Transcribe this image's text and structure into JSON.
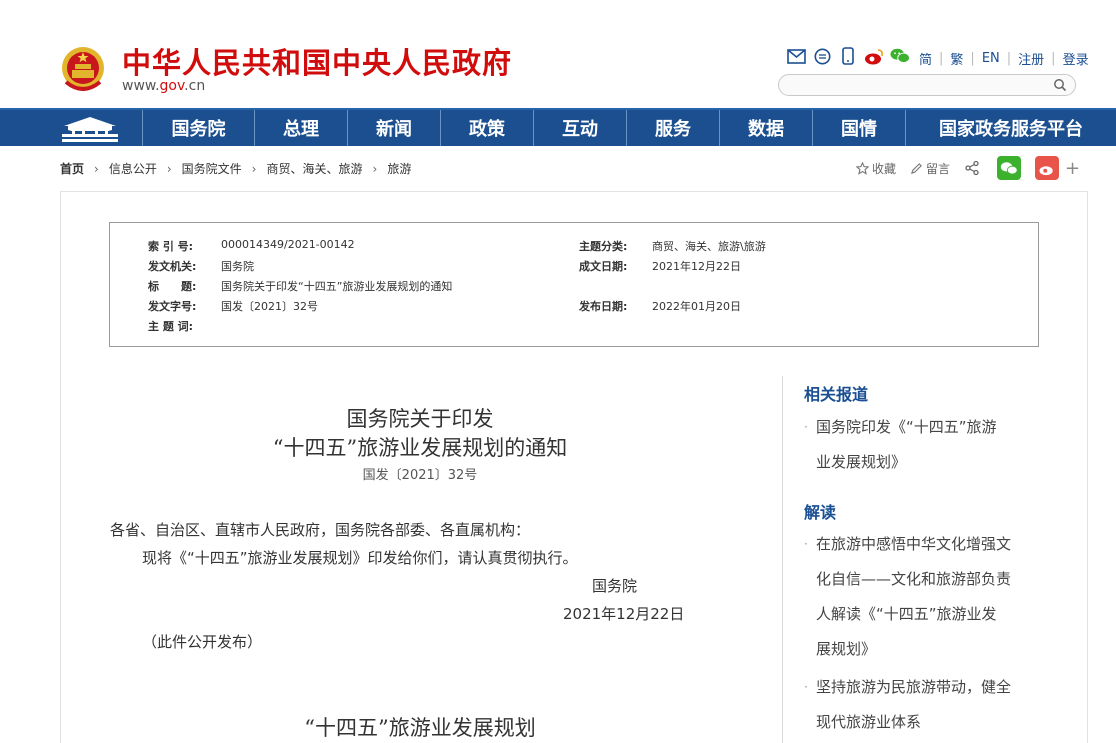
{
  "header": {
    "site_title": "中华人民共和国中央人民政府",
    "site_url_prefix": "www.",
    "site_url_domain": "gov",
    "site_url_suffix": ".cn",
    "top_links": [
      "简",
      "繁",
      "EN",
      "注册",
      "登录"
    ],
    "search_placeholder": ""
  },
  "nav": {
    "items": [
      "国务院",
      "总理",
      "新闻",
      "政策",
      "互动",
      "服务",
      "数据",
      "国情",
      "国家政务服务平台"
    ]
  },
  "breadcrumb": {
    "items": [
      "首页",
      "信息公开",
      "国务院文件",
      "商贸、海关、旅游",
      "旅游"
    ]
  },
  "tools": {
    "favorite": "收藏",
    "comment": "留言"
  },
  "meta": {
    "index_no_label": "索 引 号:",
    "index_no": "000014349/2021-00142",
    "subject_label": "主题分类:",
    "subject": "商贸、海关、旅游\\旅游",
    "issuer_label": "发文机关:",
    "issuer": "国务院",
    "written_label": "成文日期:",
    "written": "2021年12月22日",
    "title_label": "标　　题:",
    "title": "国务院关于印发“十四五”旅游业发展规划的通知",
    "doc_no_label": "发文字号:",
    "doc_no": "国发〔2021〕32号",
    "published_label": "发布日期:",
    "published": "2022年01月20日",
    "keywords_label": "主 题 词:",
    "keywords": ""
  },
  "article": {
    "title_line1": "国务院关于印发",
    "title_line2": "“十四五”旅游业发展规划的通知",
    "doc_no": "国发〔2021〕32号",
    "salutation": "各省、自治区、直辖市人民政府，国务院各部委、各直属机构：",
    "para1": "现将《“十四五”旅游业发展规划》印发给你们，请认真贯彻执行。",
    "signature": "国务院",
    "date": "2021年12月22日",
    "note": "（此件公开发布）",
    "subtitle": "“十四五”旅游业发展规划"
  },
  "sidebar": {
    "related_heading": "相关报道",
    "related": [
      [
        "国务院印发《“十四五”旅游",
        "业发展规划》"
      ]
    ],
    "interpret_heading": "解读",
    "interpret": [
      [
        "在旅游中感悟中华文化增强文",
        "化自信——文化和旅游部负责",
        "人解读《“十四五”旅游业发",
        "展规划》"
      ],
      [
        "坚持旅游为民旅游带动，健全",
        "现代旅游业体系"
      ]
    ]
  },
  "colors": {
    "brand_red": "#d10c0c",
    "nav_blue": "#1b4f8f",
    "link_blue": "#1a4f93"
  }
}
